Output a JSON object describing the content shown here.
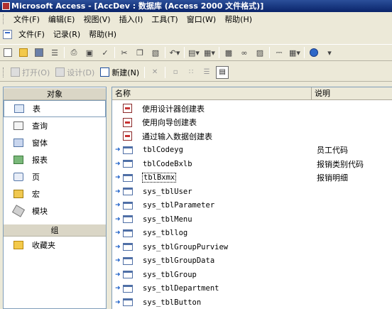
{
  "window": {
    "title": "Microsoft Access - [AccDev : 数据库 (Access 2000 文件格式)]"
  },
  "app_menu": [
    "文件(F)",
    "编辑(E)",
    "视图(V)",
    "插入(I)",
    "工具(T)",
    "窗口(W)",
    "帮助(H)"
  ],
  "db_menu": [
    "文件(F)",
    "记录(R)",
    "帮助(H)"
  ],
  "db_toolbar": {
    "open": "打开(O)",
    "design": "设计(D)",
    "new": "新建(N)"
  },
  "objects_bar": {
    "header": "对象",
    "items": [
      {
        "label": "表",
        "icon": "table-icon",
        "selected": true
      },
      {
        "label": "查询",
        "icon": "query-icon"
      },
      {
        "label": "窗体",
        "icon": "form-icon"
      },
      {
        "label": "报表",
        "icon": "report-icon"
      },
      {
        "label": "页",
        "icon": "page-icon"
      },
      {
        "label": "宏",
        "icon": "macro-icon"
      },
      {
        "label": "模块",
        "icon": "module-icon"
      }
    ],
    "groups_header": "组",
    "groups": [
      {
        "label": "收藏夹",
        "icon": "favorites-folder-icon"
      }
    ]
  },
  "list": {
    "columns": {
      "name": "名称",
      "description": "说明"
    },
    "shortcuts": [
      "使用设计器创建表",
      "使用向导创建表",
      "通过输入数据创建表"
    ],
    "tables": [
      {
        "name": "tblCodeyg",
        "description": "员工代码"
      },
      {
        "name": "tblCodeBxlb",
        "description": "报销类别代码"
      },
      {
        "name": "tblBxmx",
        "description": "报销明细",
        "focused": true
      },
      {
        "name": "sys_tblUser",
        "description": ""
      },
      {
        "name": "sys_tblParameter",
        "description": ""
      },
      {
        "name": "sys_tblMenu",
        "description": ""
      },
      {
        "name": "sys_tbllog",
        "description": ""
      },
      {
        "name": "sys_tblGroupPurview",
        "description": ""
      },
      {
        "name": "sys_tblGroupData",
        "description": ""
      },
      {
        "name": "sys_tblGroup",
        "description": ""
      },
      {
        "name": "sys_tblDepartment",
        "description": ""
      },
      {
        "name": "sys_tblButton",
        "description": ""
      }
    ]
  }
}
